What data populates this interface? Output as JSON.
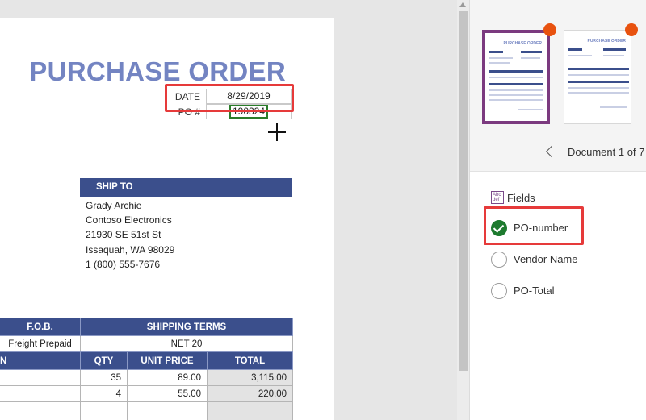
{
  "document": {
    "title": "PURCHASE ORDER",
    "date_label": "DATE",
    "date_value": "8/29/2019",
    "po_label": "PO #",
    "po_value": "190324",
    "ship_to": {
      "header": "SHIP TO",
      "lines": [
        "Grady Archie",
        "Contoso Electronics",
        "21930 SE 51st St",
        "Issaquah, WA 98029",
        "1 (800) 555-7676"
      ]
    },
    "terms_table": {
      "headers": [
        "F.O.B.",
        "SHIPPING TERMS"
      ],
      "row": [
        "Freight Prepaid",
        "NET 20"
      ]
    },
    "items_table": {
      "headers": [
        "N",
        "QTY",
        "UNIT PRICE",
        "TOTAL"
      ],
      "rows": [
        [
          "",
          "35",
          "89.00",
          "3,115.00"
        ],
        [
          "",
          "4",
          "55.00",
          "220.00"
        ],
        [
          "",
          "",
          "",
          ""
        ],
        [
          "",
          "",
          "",
          ""
        ]
      ]
    }
  },
  "panel": {
    "thumbnails": [
      {
        "mini_title": "PURCHASE ORDER",
        "selected": true
      },
      {
        "mini_title": "PURCHASE ORDER",
        "selected": false
      }
    ],
    "doc_nav": "Document 1 of 7",
    "fields_icon_text": "Abc def",
    "fields_label": "Fields",
    "fields": [
      {
        "label": "PO-number",
        "checked": true
      },
      {
        "label": "Vendor Name",
        "checked": false
      },
      {
        "label": "PO-Total",
        "checked": false
      }
    ]
  },
  "colors": {
    "title": "#7384c2",
    "header_bar": "#3b4f8c",
    "highlight": "#e63a3a",
    "check": "#1d7a2e",
    "selected_thumb": "#7b3a7f",
    "badge": "#e8520f"
  }
}
